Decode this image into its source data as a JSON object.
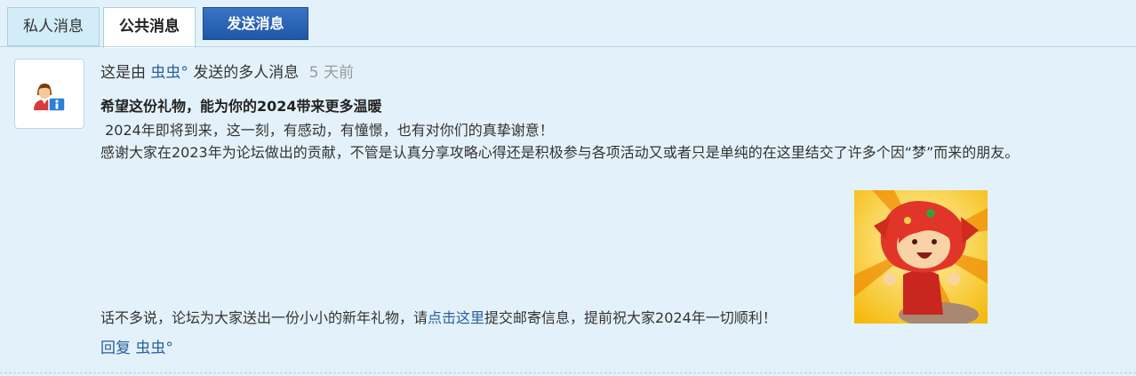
{
  "tabs": {
    "private": "私人消息",
    "public": "公共消息",
    "send": "发送消息"
  },
  "message": {
    "meta_prefix": "这是由",
    "sender": "虫虫°",
    "meta_suffix": "发送的多人消息",
    "time": "5 天前",
    "title": "希望这份礼物，能为你的2024带来更多温暖",
    "line1": " 2024年即将到来，这一刻，有感动，有憧憬，也有对你们的真挚谢意！",
    "line2": "感谢大家在2023年为论坛做出的贡献，不管是认真分享攻略心得还是积极参与各项活动又或者只是单纯的在这里结交了许多个因“梦”而来的朋友。",
    "line3_before": "话不多说，论坛为大家送出一份小小的新年礼物，请",
    "line3_link": "点击这里",
    "line3_after": "提交邮寄信息，提前祝大家2024年一切顺利！"
  },
  "reply": {
    "label": "回复",
    "name": "虫虫°"
  },
  "icons": {
    "avatar": "user-info-icon",
    "gift": "cartoon-character-image"
  },
  "colors": {
    "background": "#e3f2fa",
    "link": "#2a5e9c",
    "send_button": "#2a62b3"
  }
}
